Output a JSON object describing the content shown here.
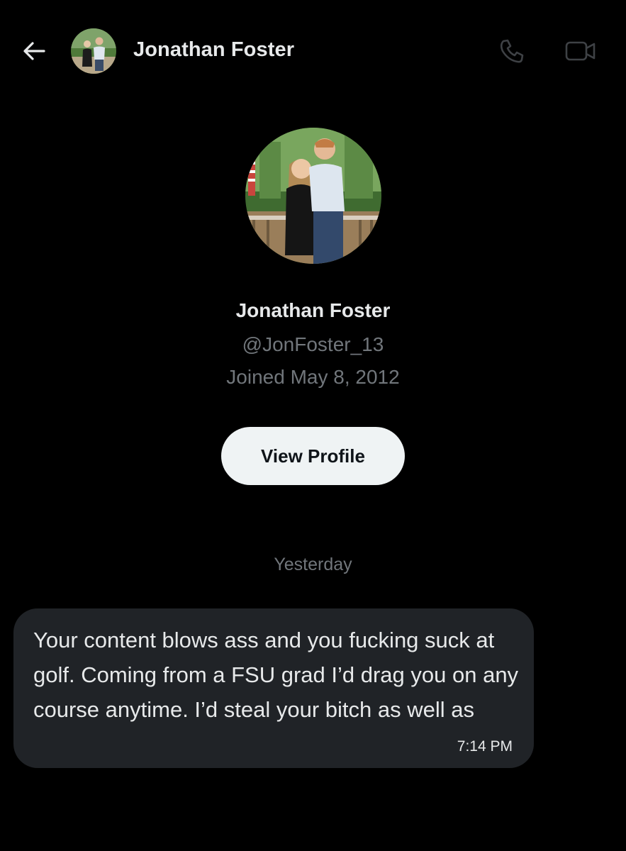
{
  "header": {
    "title": "Jonathan Foster",
    "back_icon": "arrow-left-icon",
    "call_icon": "phone-icon",
    "video_icon": "video-camera-icon"
  },
  "profile": {
    "name": "Jonathan Foster",
    "handle": "@JonFoster_13",
    "joined": "Joined May 8, 2012",
    "view_profile_label": "View Profile"
  },
  "conversation": {
    "date_divider": "Yesterday",
    "messages": [
      {
        "text": "Your content blows ass and you fucking suck at golf. Coming from a FSU grad I’d drag you on any course anytime. I’d steal your bitch as well as",
        "time": "7:14 PM"
      }
    ]
  },
  "colors": {
    "background": "#000000",
    "primary_text": "#e7e9ea",
    "secondary_text": "#71767b",
    "bubble": "#202327",
    "button_bg": "#eff3f4",
    "button_text": "#0f1419"
  }
}
